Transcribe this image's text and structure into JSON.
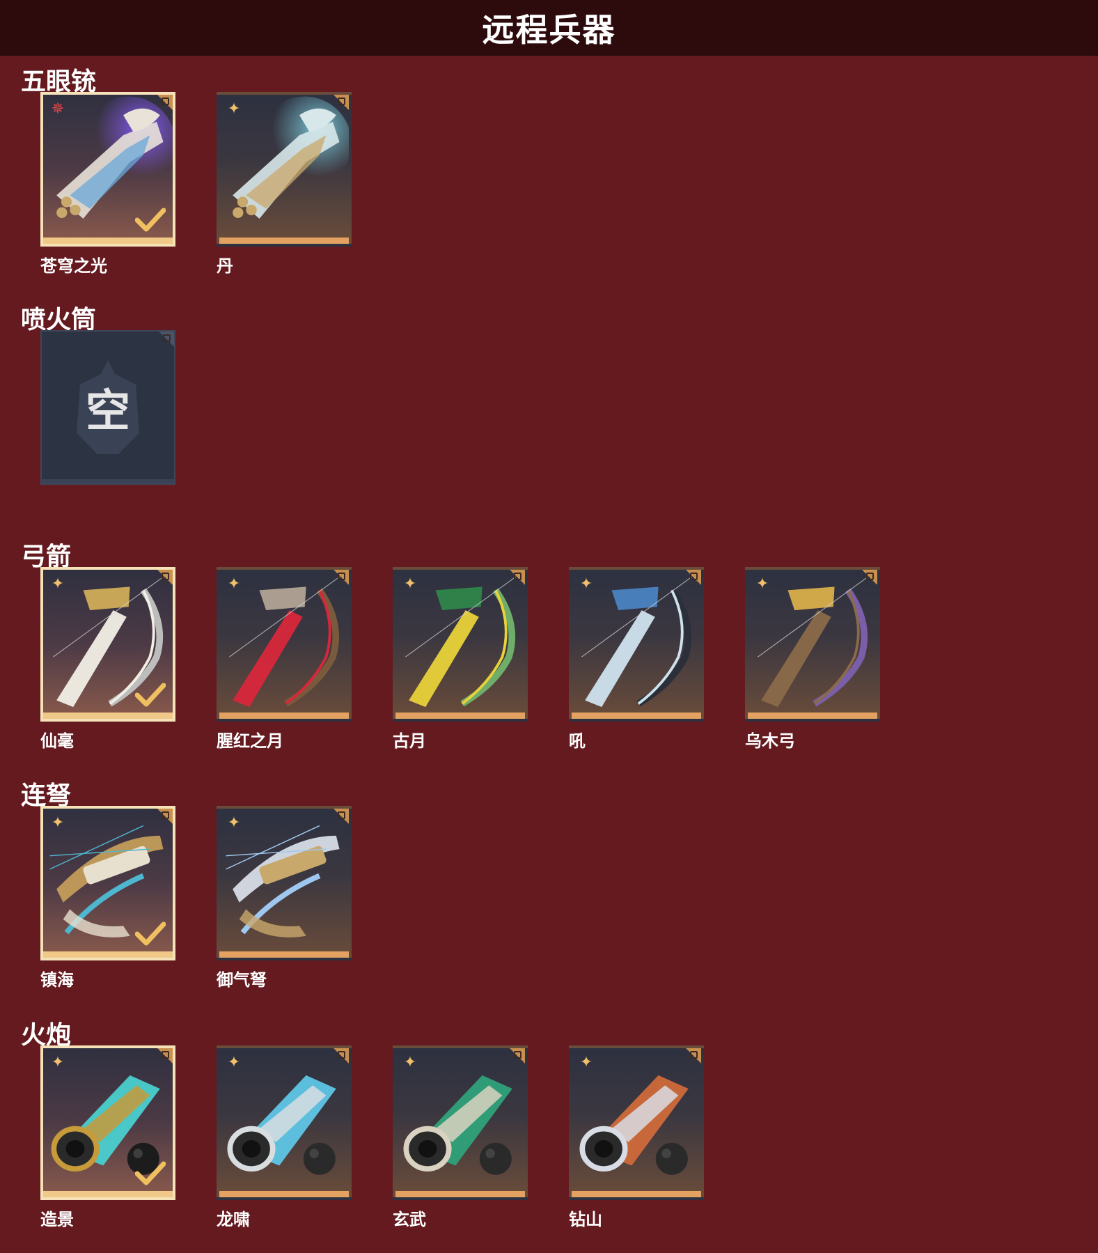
{
  "header": {
    "title": "远程兵器"
  },
  "sections": [
    {
      "title": "五眼铳",
      "items": [
        {
          "name": "苍穹之光",
          "rarity": "red",
          "equipped": true,
          "art": "blunderbuss-purple",
          "colors": [
            "#8a5cff",
            "#e8e2d8",
            "#6aa8d8"
          ]
        },
        {
          "name": "丹",
          "rarity": "gold",
          "equipped": false,
          "art": "blunderbuss-teal",
          "colors": [
            "#7fd0e0",
            "#d8e8ea",
            "#c9a86b"
          ]
        }
      ]
    },
    {
      "title": "喷火筒",
      "items": [
        {
          "name": "",
          "empty": true,
          "empty_glyph": "空"
        }
      ]
    },
    {
      "title": "弓箭",
      "items": [
        {
          "name": "仙毫",
          "rarity": "gold",
          "equipped": true,
          "art": "bow-white",
          "colors": [
            "#f2efe6",
            "#d8b25a",
            "#bdbdbd"
          ]
        },
        {
          "name": "腥红之月",
          "rarity": "gold",
          "equipped": false,
          "art": "bow-red",
          "colors": [
            "#d8273b",
            "#b8aa9a",
            "#7a5a3c"
          ]
        },
        {
          "name": "古月",
          "rarity": "gold",
          "equipped": false,
          "art": "bow-green",
          "colors": [
            "#e8d23a",
            "#2f8a4a",
            "#6fae6a"
          ]
        },
        {
          "name": "吼",
          "rarity": "gold",
          "equipped": false,
          "art": "bow-blue",
          "colors": [
            "#cfe3ee",
            "#4a86c6",
            "#2a2f3a"
          ]
        },
        {
          "name": "乌木弓",
          "rarity": "gold",
          "equipped": false,
          "art": "bow-wood",
          "colors": [
            "#8a6a4a",
            "#e1b54b",
            "#7a5fa8"
          ]
        }
      ]
    },
    {
      "title": "连弩",
      "items": [
        {
          "name": "镇海",
          "rarity": "gold",
          "equipped": true,
          "art": "crossbow-gold",
          "colors": [
            "#c9a25b",
            "#4fb6d0",
            "#e8e0cf"
          ]
        },
        {
          "name": "御气弩",
          "rarity": "gold",
          "equipped": false,
          "art": "crossbow-silver",
          "colors": [
            "#dfe6ee",
            "#9fc8f0",
            "#c9a86b"
          ]
        }
      ]
    },
    {
      "title": "火炮",
      "items": [
        {
          "name": "造景",
          "rarity": "gold",
          "equipped": true,
          "art": "cannon-jade",
          "colors": [
            "#4ad0cf",
            "#c79a3a",
            "#1c1c1c"
          ]
        },
        {
          "name": "龙啸",
          "rarity": "gold",
          "equipped": false,
          "art": "cannon-dragon",
          "colors": [
            "#5fc6e6",
            "#d8dde0",
            "#2a2a2a"
          ]
        },
        {
          "name": "玄武",
          "rarity": "gold",
          "equipped": false,
          "art": "cannon-serpent",
          "colors": [
            "#2fa27a",
            "#d9d2c0",
            "#2a2a2a"
          ]
        },
        {
          "name": "钻山",
          "rarity": "gold",
          "equipped": false,
          "art": "cannon-drill",
          "colors": [
            "#cf6a3a",
            "#d8dce4",
            "#2a2a2a"
          ]
        }
      ]
    }
  ]
}
